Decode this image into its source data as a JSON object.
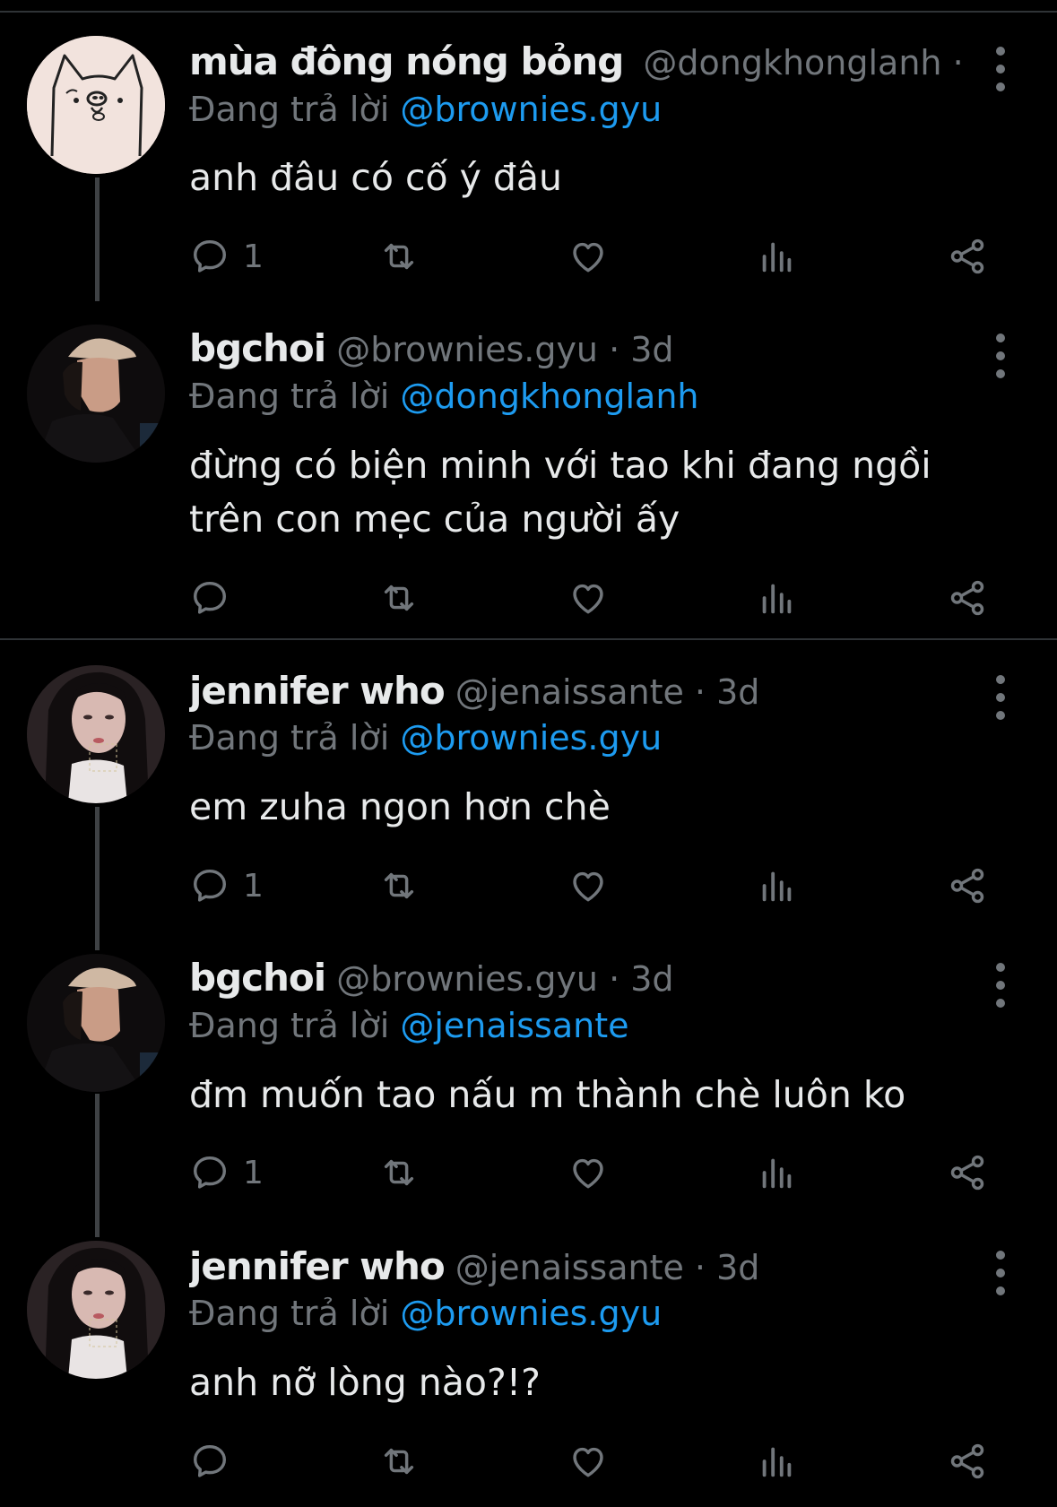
{
  "tweets": [
    {
      "name": "mùa đông nóng bỏng",
      "handle_meta": "@dongkhonglanh · ...",
      "replying_prefix": "Đang trả lời",
      "replying_to": "@brownies.gyu",
      "text": "anh đâu có cố ý đâu",
      "reply_count": "1",
      "avatar": "cat-doodle-avatar"
    },
    {
      "name": "bgchoi",
      "handle_meta": "@brownies.gyu · 3d",
      "replying_prefix": "Đang trả lời",
      "replying_to": "@dongkhonglanh",
      "text": "đừng có biện minh với tao khi đang ngồi trên con mẹc của người ấy",
      "reply_count": "",
      "avatar": "man-in-cap-avatar"
    },
    {
      "name": "jennifer who",
      "handle_meta": "@jenaissante · 3d",
      "replying_prefix": "Đang trả lời",
      "replying_to": "@brownies.gyu",
      "text": "em zuha ngon hơn chè",
      "reply_count": "1",
      "avatar": "woman-portrait-avatar"
    },
    {
      "name": "bgchoi",
      "handle_meta": "@brownies.gyu · 3d",
      "replying_prefix": "Đang trả lời",
      "replying_to": "@jenaissante",
      "text": "đm muốn tao nấu m thành chè luôn ko",
      "reply_count": "1",
      "avatar": "man-in-cap-avatar"
    },
    {
      "name": "jennifer who",
      "handle_meta": "@jenaissante · 3d",
      "replying_prefix": "Đang trả lời",
      "replying_to": "@brownies.gyu",
      "text": "anh nỡ lòng nào?!?",
      "reply_count": "",
      "avatar": "woman-portrait-avatar"
    }
  ],
  "colors": {
    "background": "#000000",
    "text": "#e7e9ea",
    "muted": "#71767b",
    "mention": "#1d9bf0",
    "divider": "#2f3336"
  },
  "icons": [
    "reply-icon",
    "retweet-icon",
    "like-icon",
    "views-icon",
    "share-icon",
    "more-icon",
    "lock-icon"
  ]
}
